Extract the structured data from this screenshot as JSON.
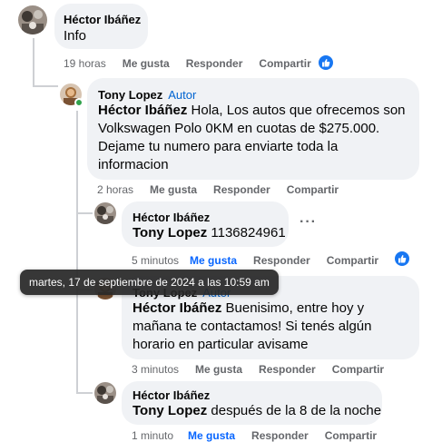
{
  "comments": [
    {
      "author": "Héctor Ibáñez",
      "text": "Info",
      "time": "19 horas",
      "like_label": "Me gusta",
      "reply_label": "Responder",
      "share_label": "Compartir",
      "has_reaction": true
    },
    {
      "author": "Tony Lopez",
      "author_tag": "Autor",
      "mention": "Héctor Ibáñez",
      "text": "Hola, Los autos que ofrecemos son Volkswagen Polo 0KM en cuotas de $275.000. Dejame tu numero para enviarte toda la informacion",
      "time": "2 horas",
      "like_label": "Me gusta",
      "reply_label": "Responder",
      "share_label": "Compartir"
    },
    {
      "author": "Héctor Ibáñez",
      "mention": "Tony Lopez",
      "text": "1136824961",
      "time": "5 minutos",
      "like_label": "Me gusta",
      "reply_label": "Responder",
      "share_label": "Compartir",
      "liked": true,
      "has_reaction": true,
      "more_label": "···"
    },
    {
      "author": "Tony Lopez",
      "author_tag": "Autor",
      "mention": "Héctor Ibáñez",
      "text": "Buenisimo, entre hoy y mañana te contactamos! Si tenés algún horario en particular avisame",
      "time": "3 minutos",
      "like_label": "Me gusta",
      "reply_label": "Responder",
      "share_label": "Compartir"
    },
    {
      "author": "Héctor Ibáñez",
      "mention": "Tony Lopez",
      "text": "después de la 8 de la noche",
      "time": "1 minuto",
      "like_label": "Me gusta",
      "reply_label": "Responder",
      "share_label": "Compartir",
      "liked": true
    }
  ],
  "tooltip": "martes, 17 de septiembre de 2024 a las 10:59 am",
  "colors": {
    "bubble": "#f0f2f5",
    "accent": "#0866ff",
    "author_tag": "#0064d1",
    "meta": "#65676b",
    "online": "#31a24c"
  }
}
